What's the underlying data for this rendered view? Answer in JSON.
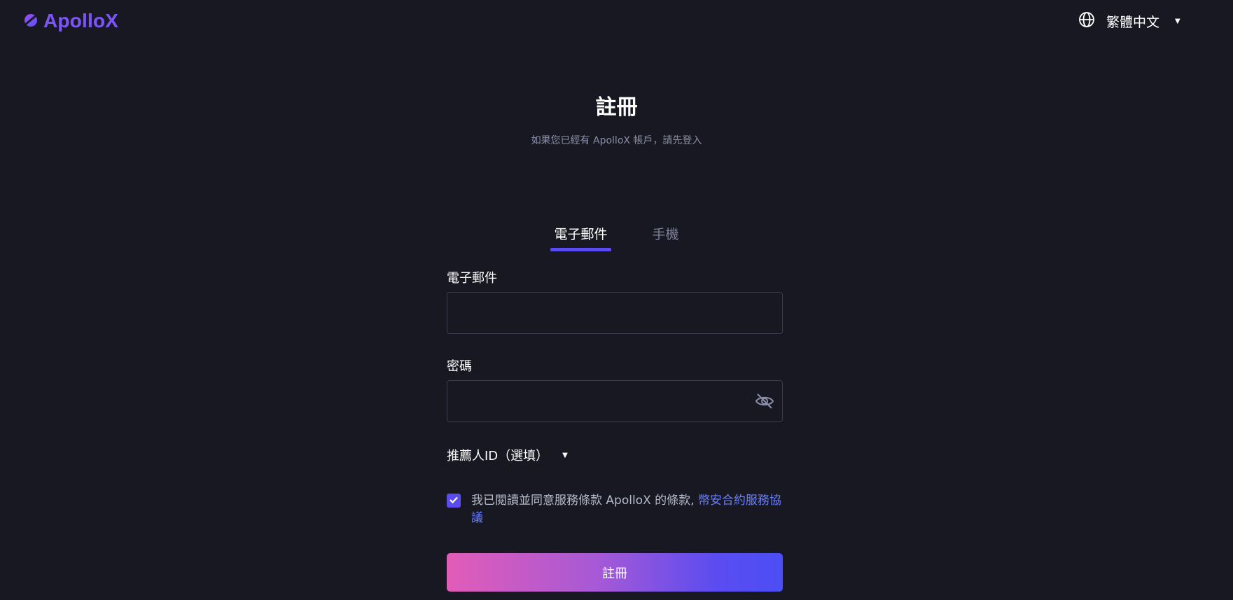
{
  "header": {
    "logo_text": "ApolloX",
    "language": "繁體中文"
  },
  "title": "註冊",
  "subtitle": "如果您已經有 ApolloX 帳戶，請先登入",
  "tabs": [
    {
      "label": "電子郵件",
      "active": true
    },
    {
      "label": "手機",
      "active": false
    }
  ],
  "form": {
    "email_label": "電子郵件",
    "email_value": "",
    "password_label": "密碼",
    "password_value": "",
    "referral_label": "推薦人ID（選填）",
    "agree_checked": true,
    "agree_text": "我已閱讀並同意服務條款 ApolloX 的條款, ",
    "agree_link": "幣安合約服務協議",
    "submit_label": "註冊"
  },
  "colors": {
    "background": "#181822",
    "accent": "#5b4cf0",
    "link": "#6b7ff5",
    "gradient_start": "#e25cb8",
    "gradient_end": "#4a4ff5"
  },
  "icons": [
    "apollox-logo-icon",
    "globe-icon",
    "caret-down-icon",
    "eye-off-icon",
    "check-icon"
  ]
}
